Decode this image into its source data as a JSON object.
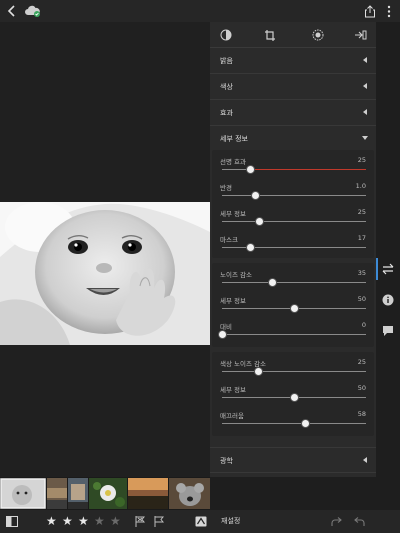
{
  "topbar": {
    "back_icon": "chevron-left-icon",
    "cloud_sync_icon": "cloud-sync-icon",
    "share_icon": "share-icon",
    "more_icon": "more-vertical-icon"
  },
  "panel_tabs": [
    {
      "icon": "presets-icon"
    },
    {
      "icon": "crop-icon"
    },
    {
      "icon": "selective-icon"
    },
    {
      "icon": "healing-icon"
    }
  ],
  "sections": {
    "light": "밝음",
    "color": "색상",
    "effects": "효과",
    "detail": "세부 정보",
    "optics": "광학"
  },
  "sharpening": [
    {
      "name": "선명 효과",
      "value": "25",
      "fraction": 0.2,
      "accent": "#c0392b"
    },
    {
      "name": "반경",
      "value": "1.0",
      "fraction": 0.23
    },
    {
      "name": "세부 정보",
      "value": "25",
      "fraction": 0.26
    },
    {
      "name": "마스크",
      "value": "17",
      "fraction": 0.2
    }
  ],
  "noise": [
    {
      "name": "노이즈 감소",
      "value": "35",
      "fraction": 0.35
    },
    {
      "name": "세부 정보",
      "value": "50",
      "fraction": 0.5
    },
    {
      "name": "대비",
      "value": "0",
      "fraction": 0.0
    }
  ],
  "color_noise": [
    {
      "name": "색상 노이즈 감소",
      "value": "25",
      "fraction": 0.25
    },
    {
      "name": "세부 정보",
      "value": "50",
      "fraction": 0.5
    },
    {
      "name": "매끄러움",
      "value": "58",
      "fraction": 0.58
    }
  ],
  "bottombar": {
    "rating": 3,
    "max_rating": 5,
    "reset_label": "재설정"
  }
}
